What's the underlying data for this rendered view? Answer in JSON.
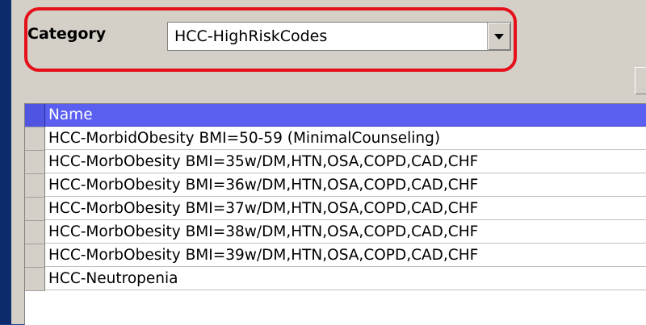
{
  "category": {
    "label": "Category",
    "selected_value": "HCC-HighRiskCodes"
  },
  "grid": {
    "header": "Name",
    "rows": [
      "HCC-MorbidObesity BMI=50-59 (MinimalCounseling)",
      "HCC-MorbObesity BMI=35w/DM,HTN,OSA,COPD,CAD,CHF",
      "HCC-MorbObesity BMI=36w/DM,HTN,OSA,COPD,CAD,CHF",
      "HCC-MorbObesity BMI=37w/DM,HTN,OSA,COPD,CAD,CHF",
      "HCC-MorbObesity BMI=38w/DM,HTN,OSA,COPD,CAD,CHF",
      "HCC-MorbObesity BMI=39w/DM,HTN,OSA,COPD,CAD,CHF",
      "HCC-Neutropenia"
    ]
  },
  "colors": {
    "highlight": "#e5101a",
    "header_bg": "#5a5ff0",
    "slide_bg": "#1a3f8c"
  },
  "icons": {
    "dropdown": "chevron-down-icon"
  }
}
